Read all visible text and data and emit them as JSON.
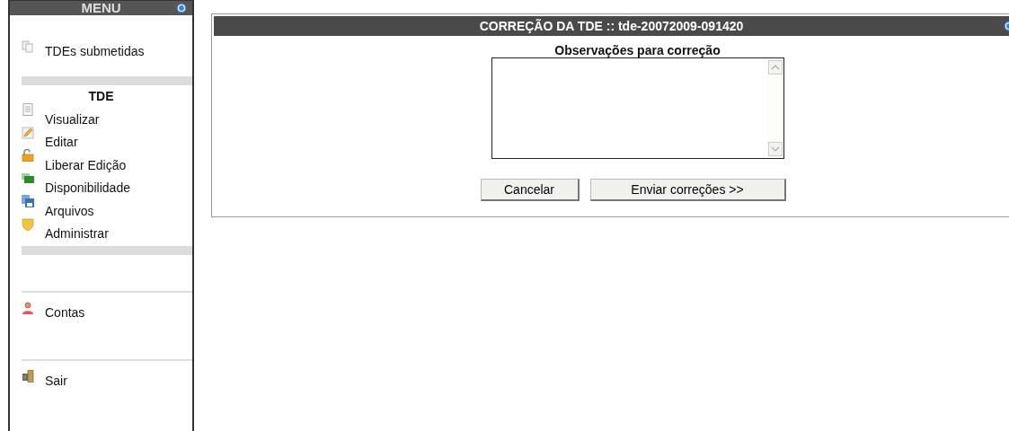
{
  "menu": {
    "title": "MENU",
    "submissions": [
      {
        "label": "TDEs submetidas",
        "kind": "pages"
      }
    ],
    "tde_heading": "TDE",
    "tde_items": [
      {
        "label": "Visualizar",
        "kind": "document"
      },
      {
        "label": "Editar",
        "kind": "pencil"
      },
      {
        "label": "Liberar Edição",
        "kind": "padlock"
      },
      {
        "label": "Disponibilidade",
        "kind": "windows"
      },
      {
        "label": "Arquivos",
        "kind": "disk"
      },
      {
        "label": "Administrar",
        "kind": "shield"
      }
    ],
    "accounts": [
      {
        "label": "Contas",
        "kind": "person"
      }
    ],
    "exit": [
      {
        "label": "Sair",
        "kind": "door"
      }
    ]
  },
  "panel": {
    "title": "CORREÇÃO DA TDE :: tde-20072009-091420",
    "field_label": "Observações para correção",
    "buttons": [
      "Cancelar",
      "Enviar correções >>"
    ]
  }
}
